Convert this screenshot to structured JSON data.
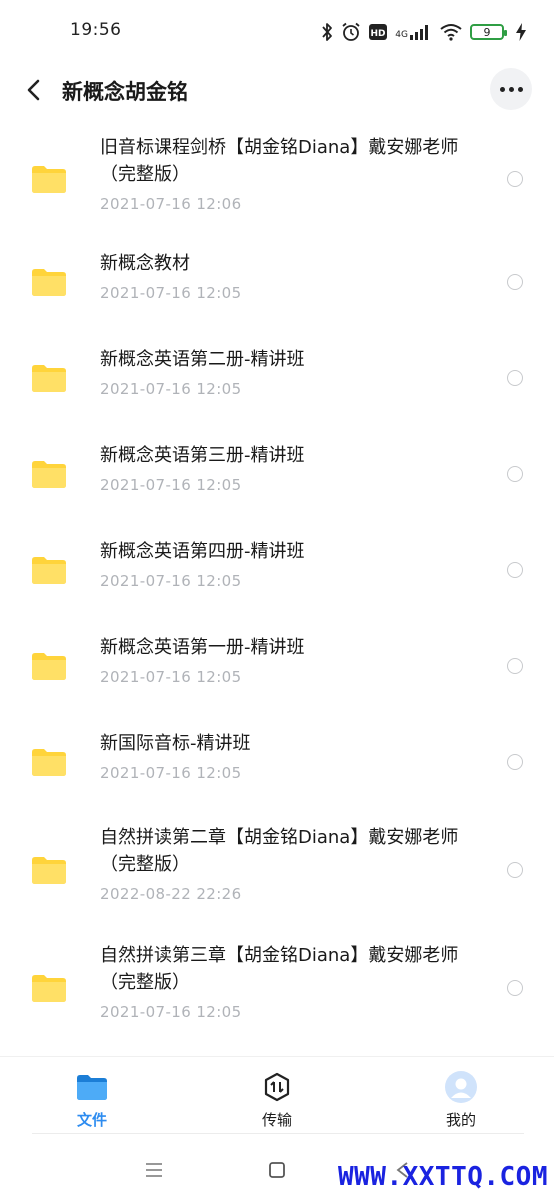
{
  "status_bar": {
    "time": "19:56",
    "network": "4G",
    "battery": "9",
    "icons": [
      "bluetooth-icon",
      "alarm-icon",
      "hd-icon",
      "signal-icon",
      "wifi-icon",
      "battery-icon",
      "charging-icon"
    ]
  },
  "header": {
    "title": "新概念胡金铭",
    "back_icon": "chevron-left-icon",
    "more_icon": "more-horizontal-icon"
  },
  "files": [
    {
      "name": "旧音标课程剑桥【胡金铭Diana】戴安娜老师（完整版）",
      "date": "2021-07-16  12:06"
    },
    {
      "name": "新概念教材",
      "date": "2021-07-16  12:05"
    },
    {
      "name": "新概念英语第二册-精讲班",
      "date": "2021-07-16  12:05"
    },
    {
      "name": "新概念英语第三册-精讲班",
      "date": "2021-07-16  12:05"
    },
    {
      "name": "新概念英语第四册-精讲班",
      "date": "2021-07-16  12:05"
    },
    {
      "name": "新概念英语第一册-精讲班",
      "date": "2021-07-16  12:05"
    },
    {
      "name": "新国际音标-精讲班",
      "date": "2021-07-16  12:05"
    },
    {
      "name": "自然拼读第二章【胡金铭Diana】戴安娜老师（完整版）",
      "date": "2022-08-22  22:26"
    },
    {
      "name": "自然拼读第三章【胡金铭Diana】戴安娜老师（完整版）",
      "date": "2021-07-16  12:05"
    }
  ],
  "bottom_nav": [
    {
      "label": "文件",
      "icon": "folder-icon",
      "active": true
    },
    {
      "label": "传输",
      "icon": "transfer-icon",
      "active": false
    },
    {
      "label": "我的",
      "icon": "avatar-icon",
      "active": false
    }
  ],
  "colors": {
    "accent": "#2d8cf0",
    "folder": "#ffd43b",
    "date_text": "#b0b3b8",
    "watermark": "#1a23e0"
  },
  "watermark": "WWW.XXTTQ.COM"
}
